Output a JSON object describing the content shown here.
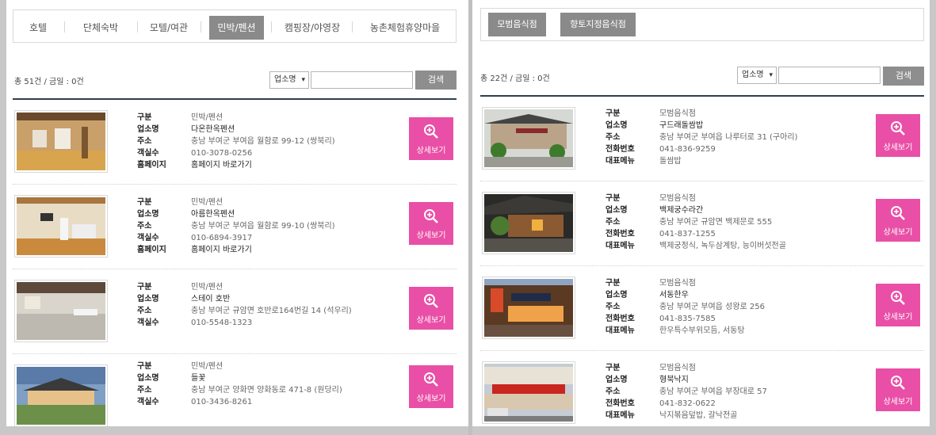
{
  "left": {
    "tabs": [
      "호텔",
      "단체숙박",
      "모텔/여관",
      "민박/펜션",
      "캠핑장/야영장",
      "농촌체험휴양마을"
    ],
    "active_tab": "민박/펜션",
    "count_text": "총 51건 / 금일 : 0건",
    "search_select": "업소명",
    "search_button": "검색",
    "labels": [
      "구분",
      "업소명",
      "주소",
      "객실수",
      "홈페이지"
    ],
    "items": [
      {
        "category": "민박/펜션",
        "name": "다온한옥펜션",
        "address": "충남 부여군 부여읍 월함로 99-12 (쌍북리)",
        "rooms": "010-3078-0256",
        "homepage": "홈페이지 바로가기"
      },
      {
        "category": "민박/펜션",
        "name": "아름한옥펜션",
        "address": "충남 부여군 부여읍 월함로 99-10 (쌍북리)",
        "rooms": "010-6894-3917",
        "homepage": "홈페이지 바로가기"
      },
      {
        "category": "민박/펜션",
        "name": "스테이 호반",
        "address": "충남 부여군 규암면 호반로164번길 14 (석우리)",
        "rooms": "010-5548-1323"
      },
      {
        "category": "민박/펜션",
        "name": "들꽃",
        "address": "충남 부여군 양화면 양화동로 471-8 (원당리)",
        "rooms": "010-3436-8261"
      }
    ]
  },
  "right": {
    "tabs": [
      "모범음식점",
      "향토지정음식점"
    ],
    "count_text": "총 22건 / 금일 : 0건",
    "search_select": "업소명",
    "search_button": "검색",
    "labels": [
      "구분",
      "업소명",
      "주소",
      "전화번호",
      "대표메뉴"
    ],
    "items": [
      {
        "category": "모범음식점",
        "name": "구드래돌쌈밥",
        "address": "충남 부여군 부여읍 나루터로 31 (구아리)",
        "phone": "041-836-9259",
        "menu": "돌쌈밥"
      },
      {
        "category": "모범음식점",
        "name": "백제궁수라간",
        "address": "충남 부여군 규암면 백제문로 555",
        "phone": "041-837-1255",
        "menu": "백제궁정식, 녹두삼계탕, 능이버섯전골"
      },
      {
        "category": "모범음식점",
        "name": "서동한우",
        "address": "충남 부여군 부여읍 성왕로 256",
        "phone": "041-835-7585",
        "menu": "한우특수부위모듬, 서동탕"
      },
      {
        "category": "모범음식점",
        "name": "형북낙지",
        "address": "충남 부여군 부여읍 부장대로 57",
        "phone": "041-832-0622",
        "menu": "낙지볶음덮밥, 갈낙전골"
      }
    ]
  },
  "detail_button": "상세보기",
  "colors": {
    "accent": "#e94fa6",
    "tab_active": "#8a8a8a",
    "divider": "#2f3e4e"
  }
}
